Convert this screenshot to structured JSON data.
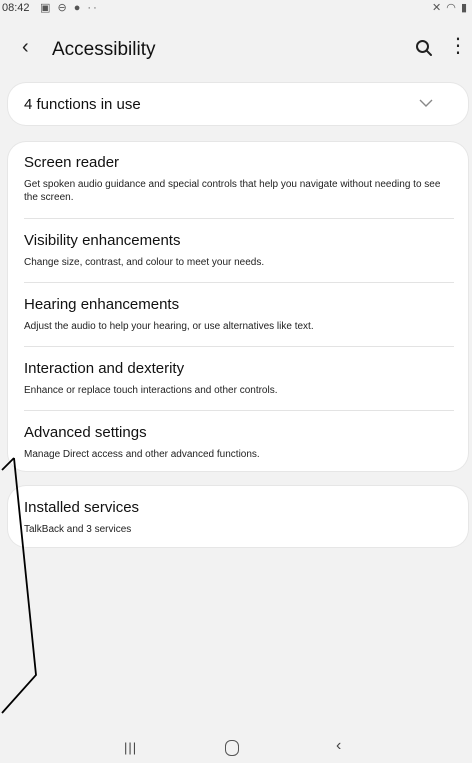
{
  "status": {
    "time": "08:42",
    "left_icons": "▣ ⊖ ●  ··",
    "right_icons": "✕ ◠ ▮"
  },
  "header": {
    "back_icon": "‹",
    "title": "Accessibility",
    "more_icon": "⋮"
  },
  "functions_card": {
    "label": "4 functions in use"
  },
  "menu": {
    "items": [
      {
        "title": "Screen reader",
        "description": "Get spoken audio guidance and special controls that help you navigate without needing to see the screen."
      },
      {
        "title": "Visibility enhancements",
        "description": "Change size, contrast, and colour to meet your needs."
      },
      {
        "title": "Hearing enhancements",
        "description": "Adjust the audio to help your hearing, or use alternatives like text."
      },
      {
        "title": "Interaction and dexterity",
        "description": "Enhance or replace touch interactions and other controls."
      },
      {
        "title": "Advanced settings",
        "description": "Manage Direct access and other advanced functions."
      }
    ]
  },
  "services": {
    "title": "Installed services",
    "description": "TalkBack and 3 services"
  },
  "navbar": {
    "recent_icon": "|||",
    "back_icon": "‹"
  },
  "colors": {
    "background": "#f2f2f2",
    "card": "#ffffff",
    "text": "#111111"
  }
}
